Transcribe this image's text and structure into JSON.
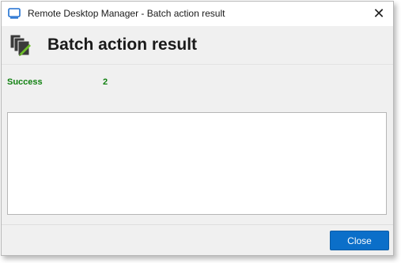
{
  "window": {
    "title": "Remote Desktop Manager - Batch action result",
    "close_glyph": "✕",
    "app_icon": "remote-desktop-manager-icon"
  },
  "header": {
    "title": "Batch action result",
    "icon": "batch-documents-icon"
  },
  "status": {
    "label": "Success",
    "count": "2",
    "color": "#108010"
  },
  "results": {
    "items": []
  },
  "footer": {
    "close_label": "Close",
    "accent": "#0b6fc9"
  }
}
